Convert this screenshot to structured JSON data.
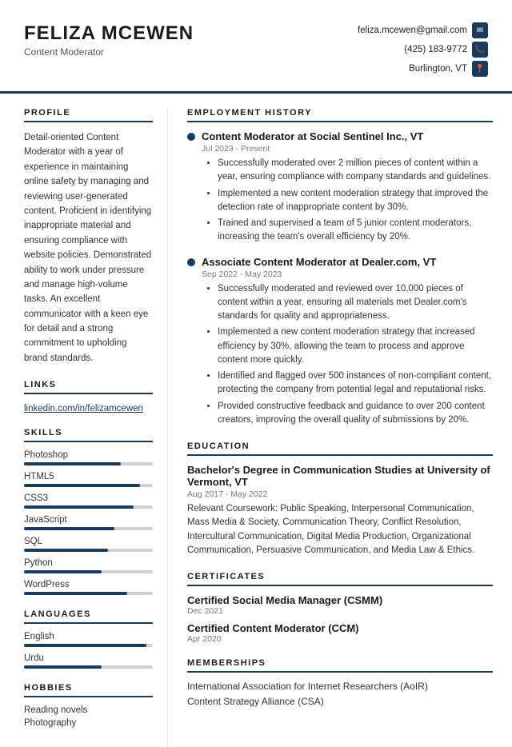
{
  "header": {
    "name": "FELIZA MCEWEN",
    "title": "Content Moderator",
    "email": "feliza.mcewen@gmail.com",
    "phone": "(425) 183-9772",
    "location": "Burlington, VT"
  },
  "profile": {
    "section_title": "PROFILE",
    "text": "Detail-oriented Content Moderator with a year of experience in maintaining online safety by managing and reviewing user-generated content. Proficient in identifying inappropriate material and ensuring compliance with website policies. Demonstrated ability to work under pressure and manage high-volume tasks. An excellent communicator with a keen eye for detail and a strong commitment to upholding brand standards."
  },
  "links": {
    "section_title": "LINKS",
    "items": [
      {
        "label": "linkedin.com/in/felizamcewen"
      }
    ]
  },
  "skills": {
    "section_title": "SKILLS",
    "items": [
      {
        "name": "Photoshop",
        "level": 75
      },
      {
        "name": "HTML5",
        "level": 90
      },
      {
        "name": "CSS3",
        "level": 85
      },
      {
        "name": "JavaScript",
        "level": 70
      },
      {
        "name": "SQL",
        "level": 65
      },
      {
        "name": "Python",
        "level": 60
      },
      {
        "name": "WordPress",
        "level": 80
      }
    ]
  },
  "languages": {
    "section_title": "LANGUAGES",
    "items": [
      {
        "name": "English",
        "level": 95
      },
      {
        "name": "Urdu",
        "level": 60
      }
    ]
  },
  "hobbies": {
    "section_title": "HOBBIES",
    "items": [
      {
        "label": "Reading novels"
      },
      {
        "label": "Photography"
      }
    ]
  },
  "employment": {
    "section_title": "EMPLOYMENT HISTORY",
    "jobs": [
      {
        "title": "Content Moderator at Social Sentinel Inc., VT",
        "dates": "Jul 2023 - Present",
        "bullets": [
          "Successfully moderated over 2 million pieces of content within a year, ensuring compliance with company standards and guidelines.",
          "Implemented a new content moderation strategy that improved the detection rate of inappropriate content by 30%.",
          "Trained and supervised a team of 5 junior content moderators, increasing the team's overall efficiency by 20%."
        ]
      },
      {
        "title": "Associate Content Moderator at Dealer.com, VT",
        "dates": "Sep 2022 - May 2023",
        "bullets": [
          "Successfully moderated and reviewed over 10,000 pieces of content within a year, ensuring all materials met Dealer.com's standards for quality and appropriateness.",
          "Implemented a new content moderation strategy that increased efficiency by 30%, allowing the team to process and approve content more quickly.",
          "Identified and flagged over 500 instances of non-compliant content, protecting the company from potential legal and reputational risks.",
          "Provided constructive feedback and guidance to over 200 content creators, improving the overall quality of submissions by 20%."
        ]
      }
    ]
  },
  "education": {
    "section_title": "EDUCATION",
    "degree": "Bachelor's Degree in Communication Studies at University of Vermont, VT",
    "dates": "Aug 2017 - May 2022",
    "coursework_label": "Relevant Coursework:",
    "coursework": "Public Speaking, Interpersonal Communication, Mass Media & Society, Communication Theory, Conflict Resolution, Intercultural Communication, Digital Media Production, Organizational Communication, Persuasive Communication, and Media Law & Ethics."
  },
  "certificates": {
    "section_title": "CERTIFICATES",
    "items": [
      {
        "name": "Certified Social Media Manager (CSMM)",
        "date": "Dec 2021"
      },
      {
        "name": "Certified Content Moderator (CCM)",
        "date": "Apr 2020"
      }
    ]
  },
  "memberships": {
    "section_title": "MEMBERSHIPS",
    "items": [
      {
        "label": "International Association for Internet Researchers (AoIR)"
      },
      {
        "label": "Content Strategy Alliance (CSA)"
      }
    ]
  }
}
